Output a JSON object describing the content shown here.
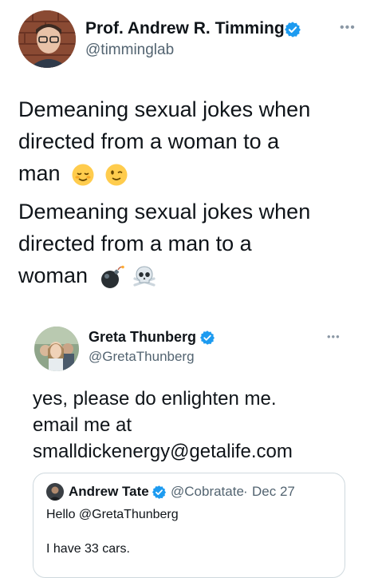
{
  "main_tweet": {
    "author_name": "Prof. Andrew R. Timming",
    "author_handle": "@timminglab",
    "more_icon": "ellipsis-icon",
    "lines": [
      "Demeaning sexual jokes when",
      "directed from a woman to a",
      "man",
      "Demeaning sexual jokes when",
      "directed from a man to a",
      "woman"
    ],
    "emoji_1": [
      "relieved-face-emoji",
      "winking-face-emoji"
    ],
    "emoji_2": [
      "bomb-emoji",
      "skull-crossbones-emoji"
    ]
  },
  "reply_tweet": {
    "author_name": "Greta Thunberg",
    "author_handle": "@GretaThunberg",
    "more_icon": "ellipsis-icon",
    "lines": [
      "yes, please do enlighten me.",
      "email me at",
      "smalldickenergy@getalife.com"
    ]
  },
  "quoted_tweet": {
    "author_name": "Andrew Tate",
    "author_handle": "@Cobratate",
    "separator": "·",
    "date": "Dec 27",
    "line1": "Hello @GretaThunberg",
    "line2": "I have 33 cars."
  },
  "colors": {
    "verified": "#1d9bf0",
    "text": "#0f1419",
    "secondary": "#536471",
    "border": "#cfd9de"
  }
}
